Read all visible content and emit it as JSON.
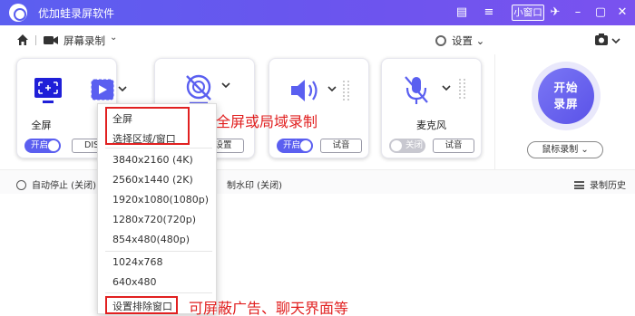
{
  "app": {
    "title": "优加蛙录屏软件",
    "mini_window": "小窗口"
  },
  "toolbar": {
    "mode": "屏幕录制",
    "settings": "设置"
  },
  "cards": {
    "screen": {
      "label": "全屏",
      "toggle": "开启",
      "button": "DISP"
    },
    "webcam": {
      "button": "设置"
    },
    "audio": {
      "toggle": "开启",
      "button": "试音"
    },
    "mic": {
      "label": "麦克风",
      "toggle": "关闭",
      "button": "试音"
    }
  },
  "record": {
    "line1": "开始",
    "line2": "录屏",
    "mouse": "鼠标录制"
  },
  "status": {
    "auto_stop": "自动停止 (关闭)",
    "watermark": "制水印 (关闭)",
    "history": "录制历史"
  },
  "dropdown": {
    "items": [
      "全屏",
      "选择区域/窗口",
      "3840x2160 (4K)",
      "2560x1440 (2K)",
      "1920x1080(1080p)",
      "1280x720(720p)",
      "854x480(480p)",
      "1024x768",
      "640x480",
      "设置排除窗口"
    ]
  },
  "annotations": {
    "top": "全屏或局域录制",
    "bottom": "可屏蔽广告、聊天界面等"
  },
  "colors": {
    "accent": "#5b5ff0",
    "highlight": "#e12020"
  }
}
